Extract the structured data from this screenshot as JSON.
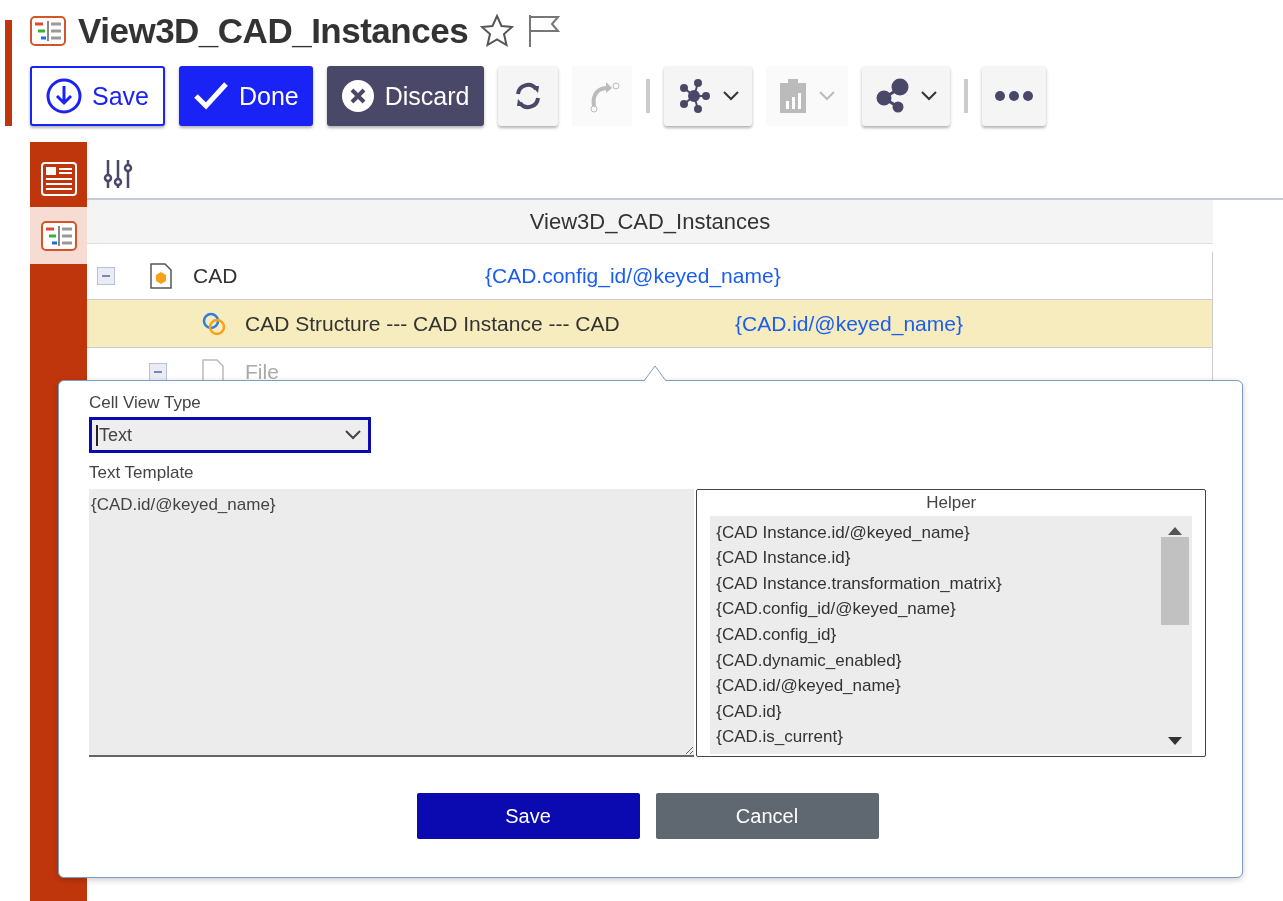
{
  "header": {
    "title": "View3D_CAD_Instances",
    "favorite": false
  },
  "toolbar": [
    {
      "kind": "save",
      "label": "Save",
      "disabled": false
    },
    {
      "kind": "done",
      "label": "Done",
      "disabled": false
    },
    {
      "kind": "discard",
      "label": "Discard",
      "disabled": false
    },
    {
      "kind": "refresh",
      "disabled": false
    },
    {
      "kind": "route",
      "disabled": true
    },
    {
      "kind": "separator"
    },
    {
      "kind": "network",
      "disabled": false,
      "dropdown": true
    },
    {
      "kind": "report",
      "disabled": true,
      "dropdown": true
    },
    {
      "kind": "share",
      "disabled": false,
      "dropdown": true
    },
    {
      "kind": "separator"
    },
    {
      "kind": "more",
      "disabled": false
    }
  ],
  "sidebar": {
    "items": [
      {
        "kind": "form",
        "selected": false
      },
      {
        "kind": "tree",
        "selected": true
      }
    ]
  },
  "tree": {
    "header": "View3D_CAD_Instances",
    "rows": [
      {
        "kind": "item",
        "name": "CAD",
        "template": "{CAD.config_id/@keyed_name}",
        "expanded": true,
        "selected": false,
        "children": [
          {
            "kind": "relationship",
            "name": "CAD Structure --- CAD Instance --- CAD",
            "template": "{CAD.id/@keyed_name}",
            "selected": true
          },
          {
            "kind": "file",
            "name": "File",
            "expanded": true,
            "selected": false
          }
        ]
      }
    ]
  },
  "popup": {
    "type_label": "Cell View Type",
    "type_value": "Text",
    "template_label": "Text Template",
    "template_value": "{CAD.id/@keyed_name}",
    "helper": {
      "title": "Helper",
      "items": [
        "{CAD Instance.id/@keyed_name}",
        "{CAD Instance.id}",
        "{CAD Instance.transformation_matrix}",
        "{CAD.config_id/@keyed_name}",
        "{CAD.config_id}",
        "{CAD.dynamic_enabled}",
        "{CAD.id/@keyed_name}",
        "{CAD.id}",
        "{CAD.is_current}"
      ]
    },
    "buttons": [
      {
        "kind": "primary",
        "label": "Save"
      },
      {
        "kind": "secondary",
        "label": "Cancel"
      }
    ]
  }
}
